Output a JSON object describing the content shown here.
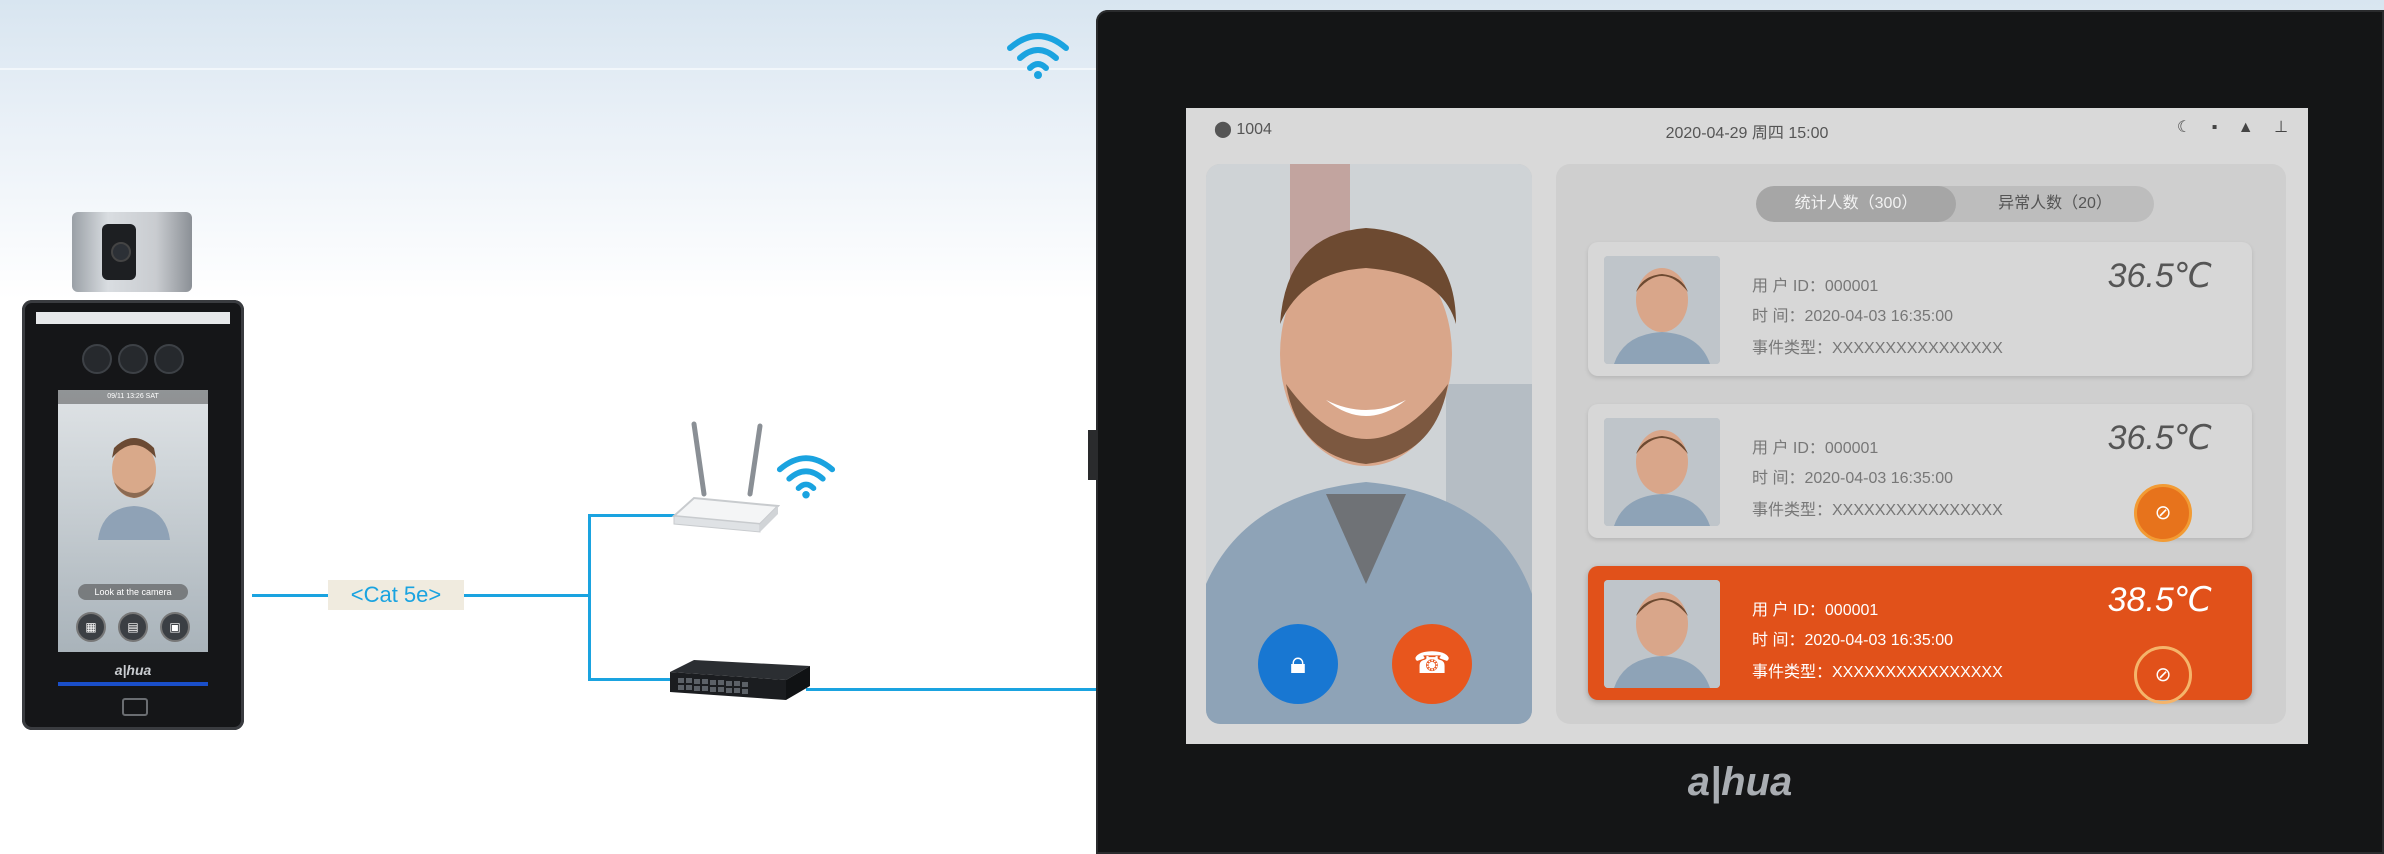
{
  "diagram": {
    "cable_label": "<Cat 5e>",
    "cable_color": "#1aa3e0"
  },
  "terminal": {
    "status_text": "09/11 13:26 SAT",
    "prompt": "Look at the camera",
    "brand": "a|hua",
    "buttons": [
      "grid-icon",
      "card-icon",
      "calendar-icon"
    ]
  },
  "monitor": {
    "brand": "a|hua",
    "status_bar": {
      "location": "1004",
      "datetime": "2020-04-29  周四  15:00",
      "icons": [
        "moon-icon",
        "sd-card-icon",
        "alert-icon",
        "network-icon"
      ]
    },
    "tabs": [
      {
        "label": "统计人数（300）",
        "active": true
      },
      {
        "label": "异常人数（20）",
        "active": false
      }
    ],
    "records": [
      {
        "user_id": "用  户 ID：000001",
        "time": "时      间：2020-04-03 16:35:00",
        "event_type": "事件类型：XXXXXXXXXXXXXXXX",
        "temperature": "36.5℃",
        "no_mask_warning": false,
        "alert": false
      },
      {
        "user_id": "用  户 ID：000001",
        "time": "时      间：2020-04-03 16:35:00",
        "event_type": "事件类型：XXXXXXXXXXXXXXXX",
        "temperature": "36.5℃",
        "no_mask_warning": true,
        "alert": false
      },
      {
        "user_id": "用  户 ID：000001",
        "time": "时      间：2020-04-03 16:35:00",
        "event_type": "事件类型：XXXXXXXXXXXXXXXX",
        "temperature": "38.5℃",
        "no_mask_warning": true,
        "alert": true
      }
    ],
    "alert_color": "#e1511a",
    "unlock_color": "#1877d2",
    "hangup_color": "#e8561d"
  }
}
